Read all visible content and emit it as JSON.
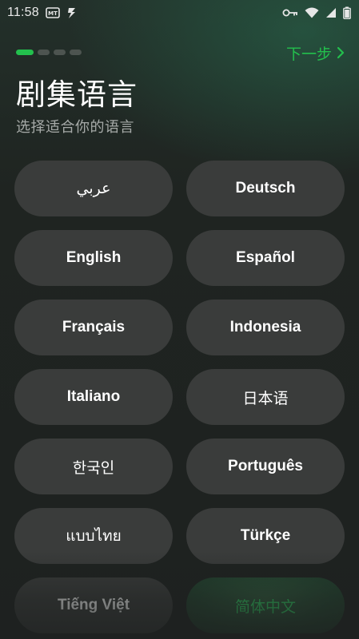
{
  "status_bar": {
    "time": "11:58",
    "left_icons": [
      "notification-box-icon",
      "flash-icon"
    ],
    "right_icons": [
      "key-icon",
      "wifi-icon",
      "signal-icon",
      "battery-icon"
    ]
  },
  "progress": {
    "total_steps": 4,
    "current_step": 1
  },
  "header": {
    "next_label": "下一步",
    "title": "剧集语言",
    "subtitle": "选择适合你的语言"
  },
  "languages": [
    {
      "label": "عربي",
      "selected": false
    },
    {
      "label": "Deutsch",
      "selected": false
    },
    {
      "label": "English",
      "selected": false
    },
    {
      "label": "Español",
      "selected": false
    },
    {
      "label": "Français",
      "selected": false
    },
    {
      "label": "Indonesia",
      "selected": false
    },
    {
      "label": "Italiano",
      "selected": false
    },
    {
      "label": "日本语",
      "selected": false
    },
    {
      "label": "한국인",
      "selected": false
    },
    {
      "label": "Português",
      "selected": false
    },
    {
      "label": "แบบไทย",
      "selected": false
    },
    {
      "label": "Türkçe",
      "selected": false
    },
    {
      "label": "Tiếng Việt",
      "selected": false
    },
    {
      "label": "简体中文",
      "selected": true
    }
  ],
  "colors": {
    "accent": "#23c04d",
    "button_bg": "#3a3c3b",
    "background": "#1f2320"
  }
}
